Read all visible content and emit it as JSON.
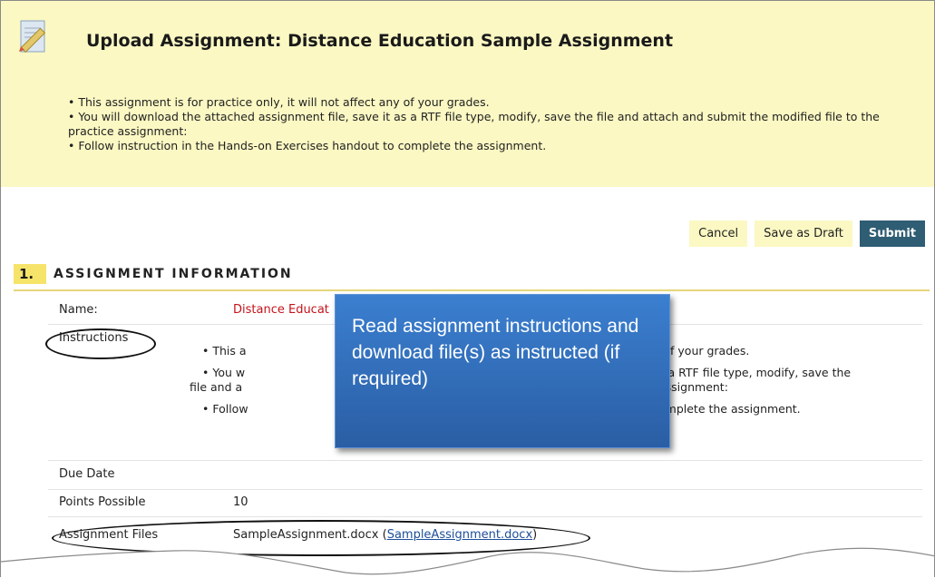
{
  "header": {
    "title": "Upload Assignment: Distance Education Sample Assignment",
    "bullets": [
      "• This assignment is for practice only, it will not affect any of your grades.",
      "• You will download the attached assignment file, save it as a RTF file type, modify, save the file and attach and submit the modified file to the practice assignment:",
      "• Follow instruction in the Hands-on Exercises handout to complete the assignment."
    ]
  },
  "actions": {
    "cancel": "Cancel",
    "save_draft": "Save as Draft",
    "submit": "Submit"
  },
  "section": {
    "number": "1.",
    "title": "ASSIGNMENT INFORMATION"
  },
  "info": {
    "name_label": "Name:",
    "name_value": "Distance Educat",
    "instructions_label": "Instructions",
    "instructions": [
      "• This a",
      "• You w",
      "file and a",
      "• Follow"
    ],
    "instructions_right": [
      "y of your grades.",
      "s a RTF file type, modify, save the",
      "assignment:",
      "omplete the assignment."
    ],
    "due_label": "Due Date",
    "points_label": "Points Possible",
    "points_value": "10",
    "files_label": "Assignment Files",
    "file_name": "SampleAssignment.docx",
    "file_link": "SampleAssignment.docx"
  },
  "callout": "Read assignment instructions and download file(s) as instructed (if required)",
  "colors": {
    "header_bg": "#fbf8c3",
    "submit_bg": "#2f5d73",
    "section_accent": "#f6e46a",
    "callout_bg": "#3b7fd0",
    "name_red": "#c4131b"
  }
}
